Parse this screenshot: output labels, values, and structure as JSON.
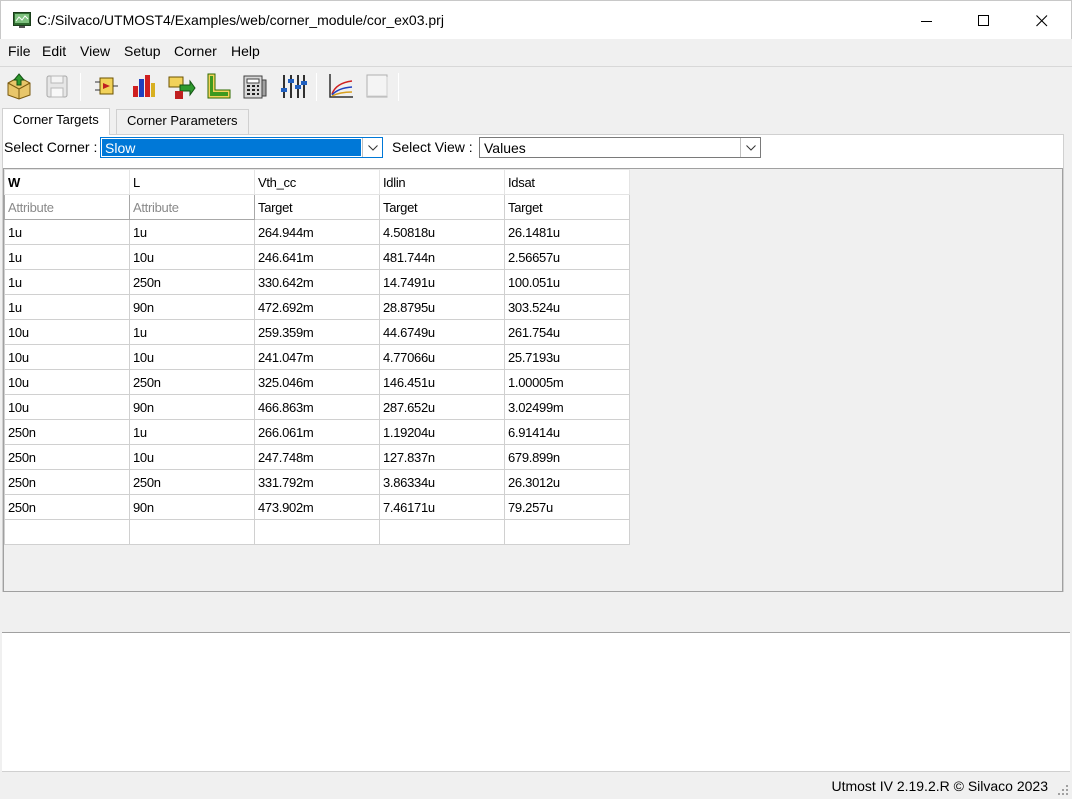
{
  "window": {
    "title": "C:/Silvaco/UTMOST4/Examples/web/corner_module/cor_ex03.prj",
    "minimize_glyph": "—",
    "maximize_glyph": "☐",
    "close_glyph": "✕"
  },
  "menu": [
    "File",
    "Edit",
    "View",
    "Setup",
    "Corner",
    "Help"
  ],
  "toolbar": {
    "buttons": [
      "open-project-icon",
      "save-icon",
      "corner-module-icon",
      "bar-chart-icon",
      "transfer-icon",
      "device-l-icon",
      "calculator-icon",
      "sliders-icon",
      "plot-icon",
      "blank-page-icon"
    ]
  },
  "tabs": [
    {
      "label": "Corner Targets",
      "active": true
    },
    {
      "label": "Corner Parameters",
      "active": false
    }
  ],
  "selectors": {
    "corner_label": "Select Corner :",
    "corner_value": "Slow",
    "view_label": "Select View :",
    "view_value": "Values"
  },
  "grid": {
    "headers": [
      "W",
      "L",
      "Vth_cc",
      "Idlin",
      "Idsat"
    ],
    "subheaders": [
      "Attribute",
      "Attribute",
      "Target",
      "Target",
      "Target"
    ],
    "rows": [
      [
        "1u",
        "1u",
        "264.944m",
        "4.50818u",
        "26.1481u"
      ],
      [
        "1u",
        "10u",
        "246.641m",
        "481.744n",
        "2.56657u"
      ],
      [
        "1u",
        "250n",
        "330.642m",
        "14.7491u",
        "100.051u"
      ],
      [
        "1u",
        "90n",
        "472.692m",
        "28.8795u",
        "303.524u"
      ],
      [
        "10u",
        "1u",
        "259.359m",
        "44.6749u",
        "261.754u"
      ],
      [
        "10u",
        "10u",
        "241.047m",
        "4.77066u",
        "25.7193u"
      ],
      [
        "10u",
        "250n",
        "325.046m",
        "146.451u",
        "1.00005m"
      ],
      [
        "10u",
        "90n",
        "466.863m",
        "287.652u",
        "3.02499m"
      ],
      [
        "250n",
        "1u",
        "266.061m",
        "1.19204u",
        "6.91414u"
      ],
      [
        "250n",
        "10u",
        "247.748m",
        "127.837n",
        "679.899n"
      ],
      [
        "250n",
        "250n",
        "331.792m",
        "3.86334u",
        "26.3012u"
      ],
      [
        "250n",
        "90n",
        "473.902m",
        "7.46171u",
        "79.257u"
      ],
      [
        "",
        "",
        "",
        "",
        ""
      ]
    ]
  },
  "status": {
    "text": "Utmost IV 2.19.2.R © Silvaco 2023"
  },
  "colors": {
    "selection": "#0078d7",
    "chrome": "#f0f0f0"
  }
}
